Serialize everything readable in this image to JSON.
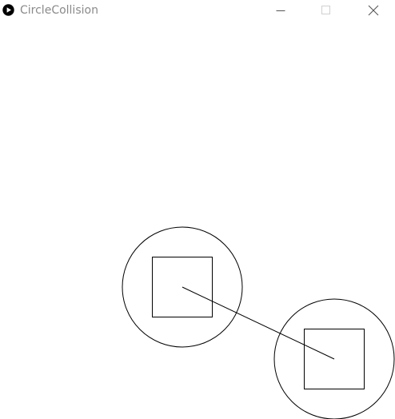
{
  "window": {
    "title": "CircleCollision",
    "app_icon": "play-circle-icon",
    "controls": {
      "minimize_icon": "minimize-icon",
      "maximize_icon": "maximize-icon",
      "close_icon": "close-icon",
      "maximize_enabled": false
    }
  },
  "colors": {
    "background": "#ffffff",
    "stroke": "#000000",
    "title_text": "#8a8a8a",
    "control_icon": "#555555",
    "control_icon_disabled": "#d0d0d0"
  }
}
